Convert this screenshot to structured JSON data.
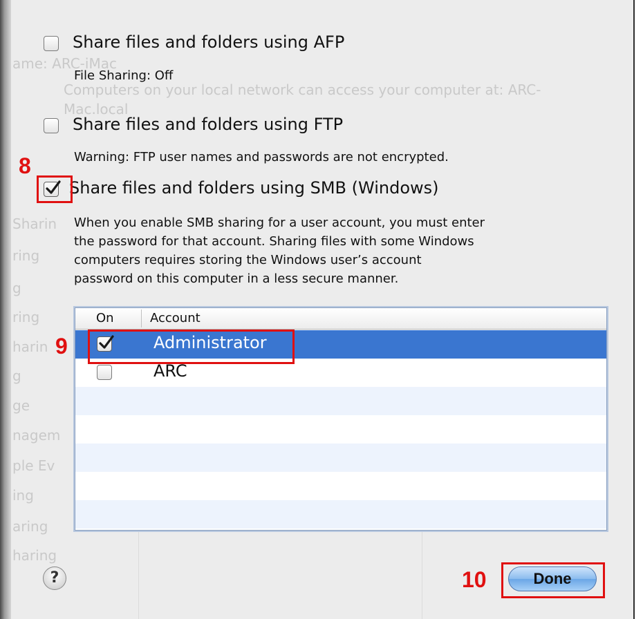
{
  "options": [
    {
      "label": "Share files and folders using AFP",
      "note": "File Sharing: Off",
      "checked": false
    },
    {
      "label": "Share files and folders using FTP",
      "note": "Warning: FTP user names and passwords are not encrypted.",
      "checked": false
    },
    {
      "label": "Share files and folders using SMB (Windows)",
      "checked": true,
      "note_lines": [
        "When you enable SMB sharing for a user account, you must enter",
        "the password for that account. Sharing files with some Windows",
        "computers requires storing the Windows user’s account",
        "password on this computer in a less secure manner."
      ]
    }
  ],
  "table": {
    "columns": [
      "On",
      "Account"
    ],
    "rows": [
      {
        "account": "Administrator",
        "on": true,
        "selected": true
      },
      {
        "account": "ARC",
        "on": false,
        "selected": false
      }
    ]
  },
  "buttons": {
    "help": "?",
    "done": "Done"
  },
  "annotations": {
    "step8": "8",
    "step9": "9",
    "step10": "10"
  },
  "background_ghost_text": {
    "line1": "ame:    ARC-iMac",
    "line2": "Computers on your local network can access your computer at: ARC-",
    "line3": "Mac.local",
    "sidebar": [
      "Sharin",
      "ring",
      "g",
      "ring",
      "harin",
      "g",
      "ge",
      "nagem",
      "ple Ev",
      "ing",
      "aring",
      "haring"
    ]
  },
  "colors": {
    "annotation_red": "#e01010",
    "selection_blue": "#3a76d0",
    "done_button": "#8bbcee"
  }
}
